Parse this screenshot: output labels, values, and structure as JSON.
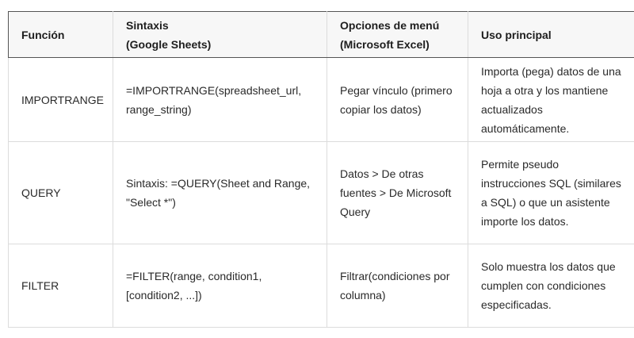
{
  "table": {
    "headers": [
      "Función",
      "Sintaxis\n(Google Sheets)",
      "Opciones de menú\n(Microsoft Excel)",
      "Uso principal"
    ],
    "rows": [
      {
        "funcion": "IMPORTRANGE",
        "sintaxis": "=IMPORTRANGE(spreadsheet_url, range_string)",
        "opciones": "Pegar vínculo (primero copiar los datos)",
        "uso": "Importa (pega) datos de una hoja a otra y los mantiene actualizados automáticamente."
      },
      {
        "funcion": "QUERY",
        "sintaxis": "Sintaxis: =QUERY(Sheet and Range, \"Select *\")",
        "opciones": "Datos > De otras fuentes > De Microsoft Query",
        "uso": "Permite pseudo instrucciones SQL (similares a SQL) o que un asistente importe los datos."
      },
      {
        "funcion": "FILTER",
        "sintaxis": "=FILTER(range, condition1, [condition2, ...])",
        "opciones": "Filtrar(condiciones por columna)",
        "uso": "Solo muestra los datos que cumplen con condiciones especificadas."
      }
    ]
  }
}
